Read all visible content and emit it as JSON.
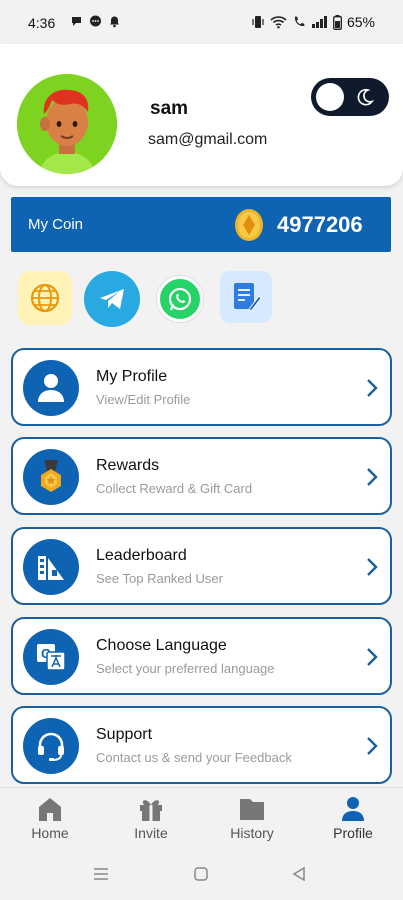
{
  "status_bar": {
    "time": "4:36",
    "battery": "65%"
  },
  "profile": {
    "name": "sam",
    "email": "sam@gmail.com"
  },
  "coin": {
    "label": "My Coin",
    "value": "4977206"
  },
  "shortcuts": [
    {
      "icon": "web-icon"
    },
    {
      "icon": "telegram-icon"
    },
    {
      "icon": "whatsapp-icon"
    },
    {
      "icon": "notes-icon"
    }
  ],
  "menu": [
    {
      "title": "My Profile",
      "subtitle": "View/Edit Profile",
      "icon": "person-icon"
    },
    {
      "title": "Rewards",
      "subtitle": "Collect Reward & Gift Card",
      "icon": "medal-icon"
    },
    {
      "title": "Leaderboard",
      "subtitle": "See Top Ranked User",
      "icon": "leaderboard-icon"
    },
    {
      "title": "Choose Language",
      "subtitle": "Select your preferred language",
      "icon": "translate-icon"
    },
    {
      "title": "Support",
      "subtitle": "Contact us & send your Feedback",
      "icon": "headset-icon"
    }
  ],
  "bottom_nav": [
    {
      "label": "Home",
      "icon": "home-icon"
    },
    {
      "label": "Invite",
      "icon": "gift-icon"
    },
    {
      "label": "History",
      "icon": "folder-icon"
    },
    {
      "label": "Profile",
      "icon": "profile-icon",
      "active": true
    }
  ],
  "colors": {
    "primary": "#0e63b3",
    "card_border": "#1a5f9e",
    "avatar_bg": "#7ed321",
    "toggle_bg": "#0f1b2d"
  }
}
